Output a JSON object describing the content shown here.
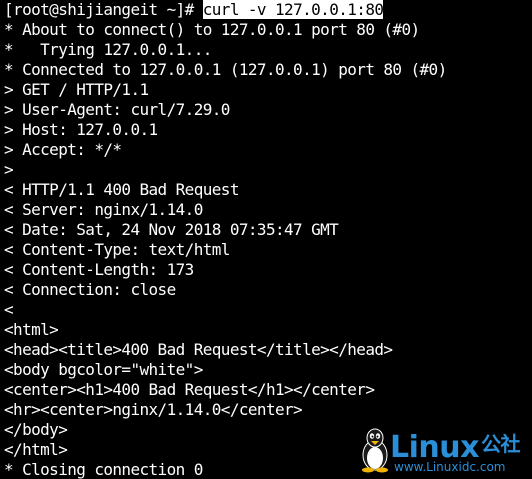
{
  "terminal": {
    "prompt": "[root@shijiangeit ~]# ",
    "command": "curl -v 127.0.0.1:80",
    "lines": [
      "* About to connect() to 127.0.0.1 port 80 (#0)",
      "*   Trying 127.0.0.1...",
      "* Connected to 127.0.0.1 (127.0.0.1) port 80 (#0)",
      "> GET / HTTP/1.1",
      "> User-Agent: curl/7.29.0",
      "> Host: 127.0.0.1",
      "> Accept: */*",
      ">",
      "< HTTP/1.1 400 Bad Request",
      "< Server: nginx/1.14.0",
      "< Date: Sat, 24 Nov 2018 07:35:47 GMT",
      "< Content-Type: text/html",
      "< Content-Length: 173",
      "< Connection: close",
      "<",
      "<html>",
      "<head><title>400 Bad Request</title></head>",
      "<body bgcolor=\"white\">",
      "<center><h1>400 Bad Request</h1></center>",
      "<hr><center>nginx/1.14.0</center>",
      "</body>",
      "</html>",
      "* Closing connection 0"
    ]
  },
  "watermark": {
    "brand": "Linux",
    "brand_suffix": "公社",
    "url": "www.Linuxidc.com",
    "icon": "tux-penguin-icon",
    "color": "#2a8fd8"
  },
  "colors": {
    "background": "#000000",
    "foreground": "#ffffff"
  }
}
